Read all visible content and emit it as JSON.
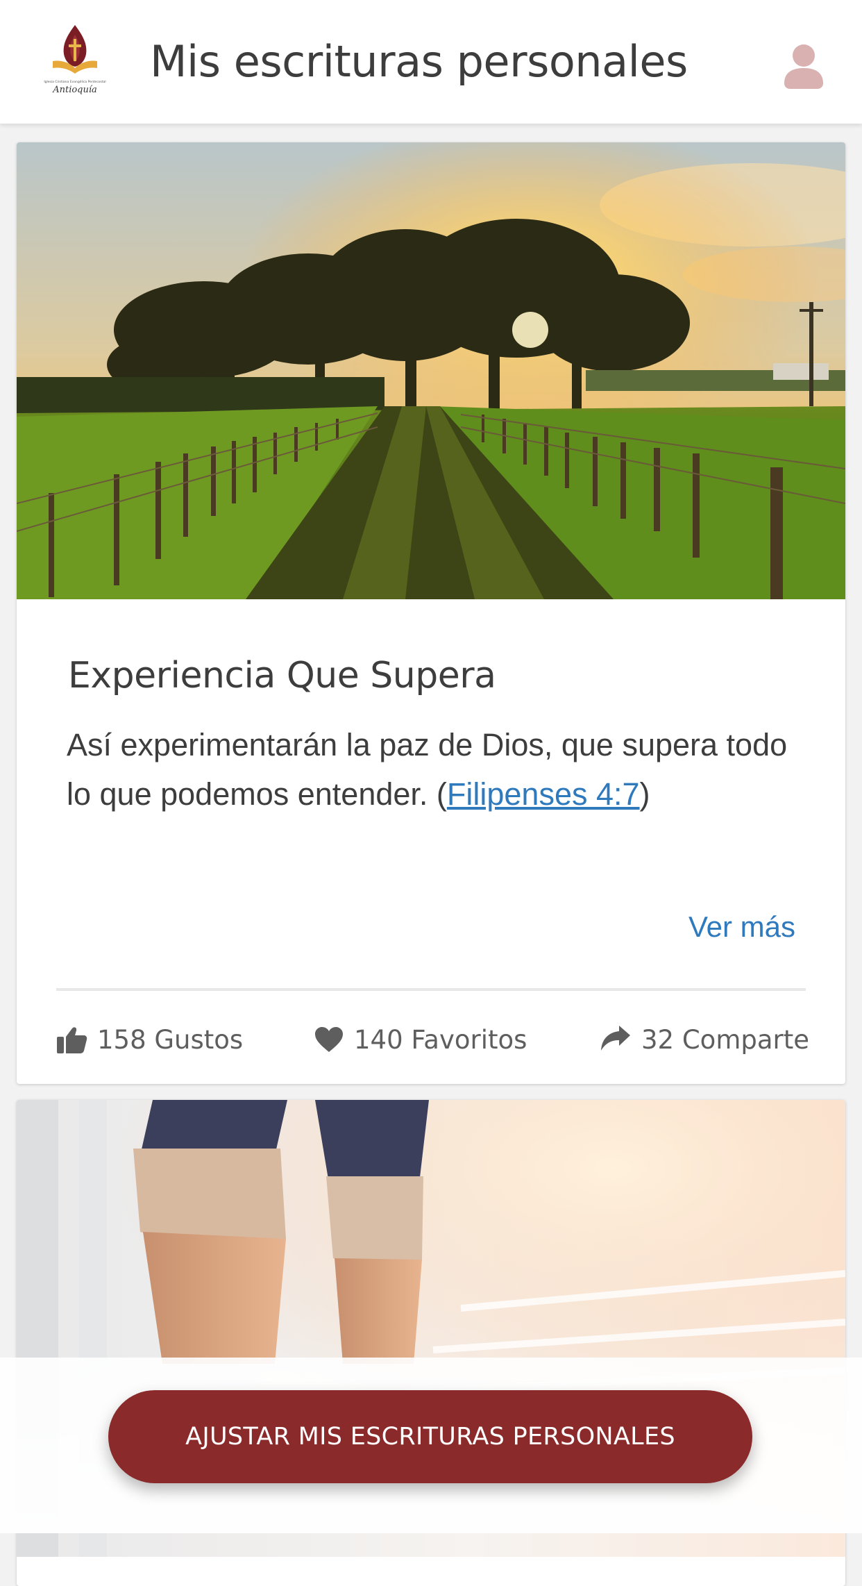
{
  "header": {
    "title": "Mis escrituras personales",
    "logo_text_top": "Iglesia Cristiana Evangélica Pentecostal",
    "logo_text_script": "Antioquía",
    "avatar_icon": "user-icon"
  },
  "cards": [
    {
      "image": "sunset-country-road-fence-trees",
      "title": "Experiencia Que Supera",
      "text": "Así experimentarán la paz de Dios, que supera todo lo que podemos entender. (",
      "reference": "Filipenses 4:7",
      "text_end": ")",
      "see_more": "Ver más",
      "likes": "158 Gustos",
      "favorites": "140 Favoritos",
      "shares": "32 Comparte"
    },
    {
      "image": "person-walking-up-stairs-bright-light"
    }
  ],
  "action_button": {
    "label": "AJUSTAR MIS ESCRITURAS PERSONALES"
  },
  "colors": {
    "brand": "#8b2a2b",
    "link": "#2f79bd",
    "text": "#3d3d3d",
    "avatar": "#d9b1b1"
  }
}
